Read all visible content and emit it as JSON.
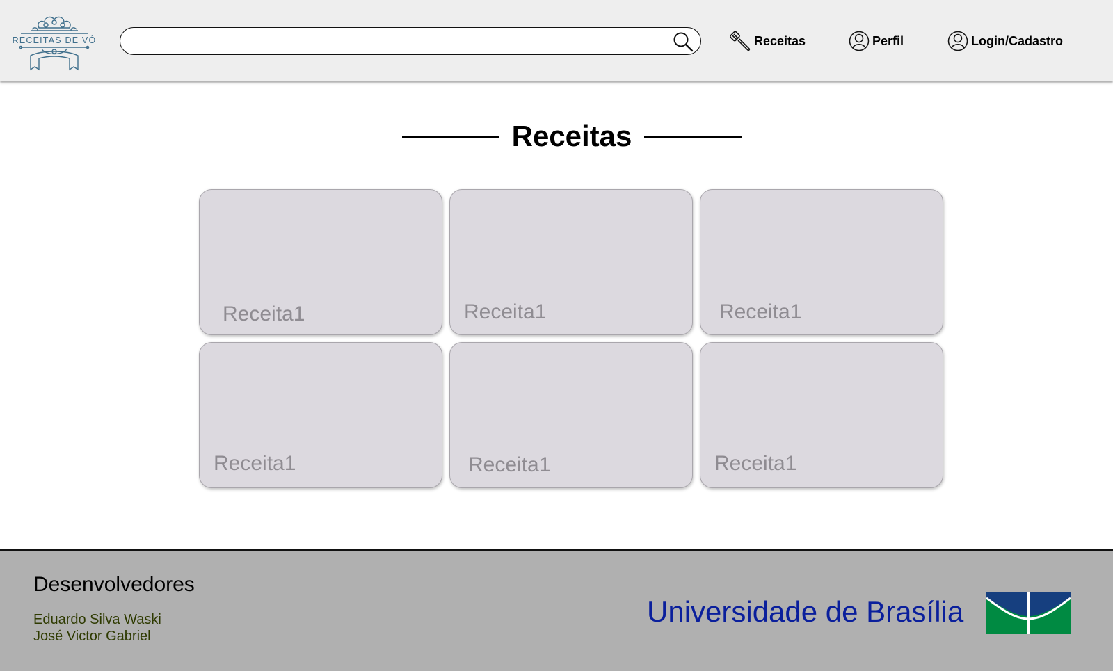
{
  "header": {
    "logo_text": "RECEITAS DE VÓ",
    "search": {
      "value": "",
      "placeholder": ""
    },
    "nav": [
      {
        "label": "Receitas",
        "icon": "spatula-icon"
      },
      {
        "label": "Perfil",
        "icon": "user-icon"
      },
      {
        "label": "Login/Cadastro",
        "icon": "user-icon"
      }
    ]
  },
  "main": {
    "title": "Receitas",
    "cards": [
      {
        "label": "Receita1"
      },
      {
        "label": "Receita1"
      },
      {
        "label": "Receita1"
      },
      {
        "label": "Receita1"
      },
      {
        "label": "Receita1"
      },
      {
        "label": "Receita1"
      }
    ]
  },
  "footer": {
    "developers_title": "Desenvolvedores",
    "developers": [
      "Eduardo Silva Waski",
      "José Victor Gabriel"
    ],
    "university": "Universidade de Brasília"
  },
  "colors": {
    "header_bg": "#eeeeee",
    "card_bg": "#dcd9df",
    "footer_bg": "#b0b0b0",
    "logo_blue": "#3f6f8c",
    "unb_text": "#0a1f9c",
    "unb_blue": "#163f7f",
    "unb_green": "#008a42"
  }
}
